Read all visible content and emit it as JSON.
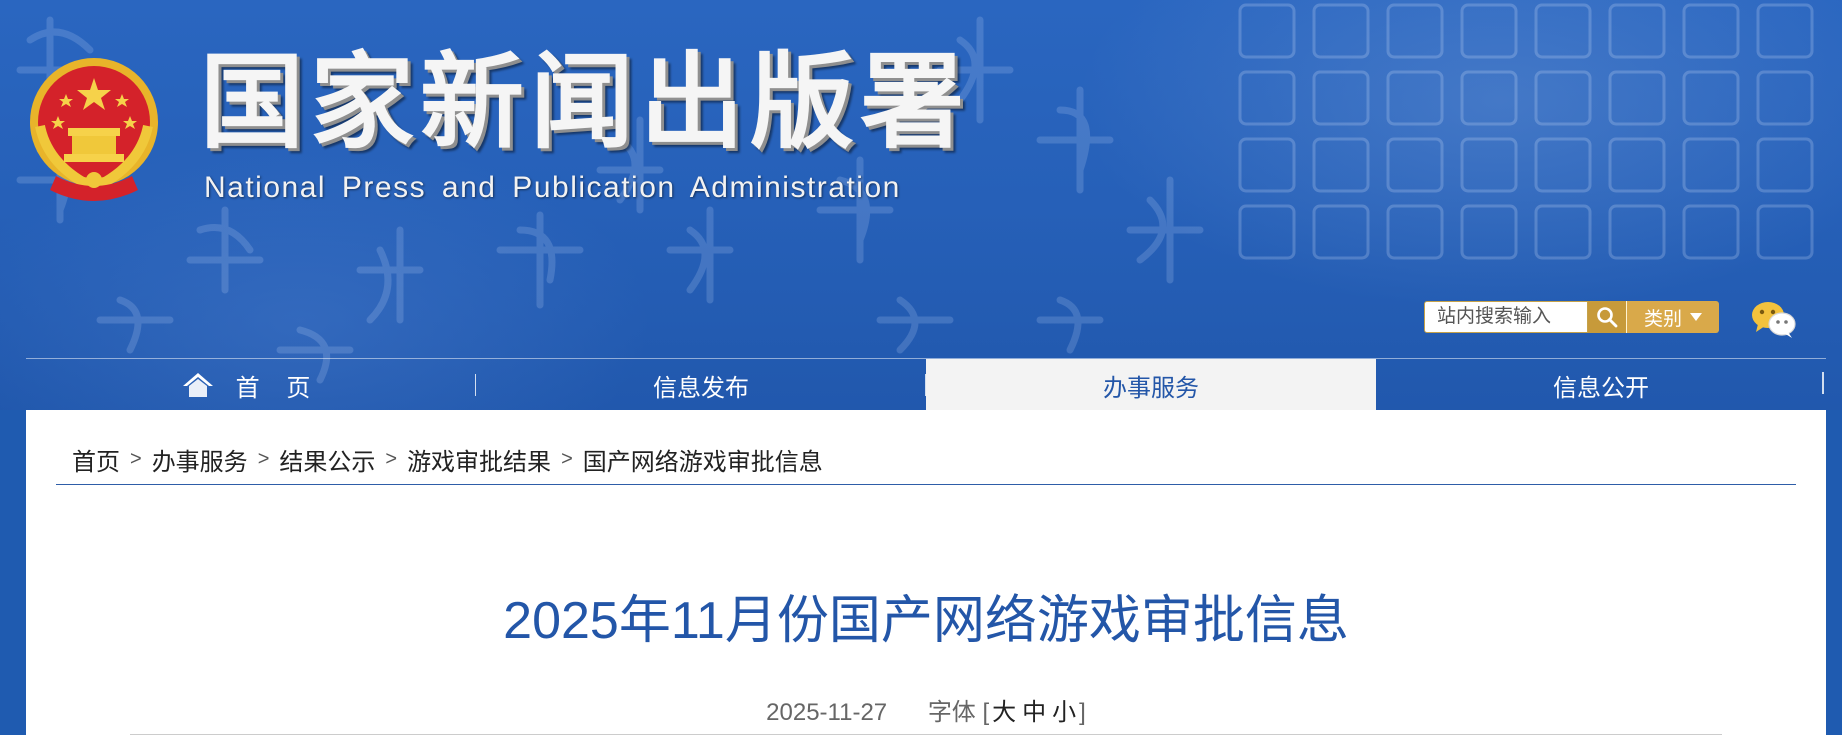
{
  "header": {
    "title": "国家新闻出版署",
    "subtitle": "National  Press and Publication Administration",
    "emblem_icon": "national-emblem-icon"
  },
  "search": {
    "placeholder": "站内搜索输入",
    "category_label": "类别",
    "button_icon": "search-icon"
  },
  "social": {
    "icon": "wechat-icon"
  },
  "nav": {
    "items": [
      {
        "label": "首 页",
        "icon": "home-icon",
        "active": false
      },
      {
        "label": "信息发布",
        "active": false
      },
      {
        "label": "办事服务",
        "active": true
      },
      {
        "label": "信息公开",
        "active": false
      }
    ]
  },
  "breadcrumb": {
    "items": [
      "首页",
      "办事服务",
      "结果公示",
      "游戏审批结果",
      "国产网络游戏审批信息"
    ],
    "separator": ">"
  },
  "article": {
    "title": "2025年11月份国产网络游戏审批信息",
    "date": "2025-11-27",
    "font_label": "字体",
    "font_bracket_open": "[",
    "font_large": "大",
    "font_medium": "中",
    "font_small": "小",
    "font_bracket_close": "]"
  },
  "colors": {
    "header_blue": "#2660b8",
    "title_blue": "#2356a8",
    "search_gold": "#c79a3a",
    "category_gold": "#d9a94a"
  }
}
